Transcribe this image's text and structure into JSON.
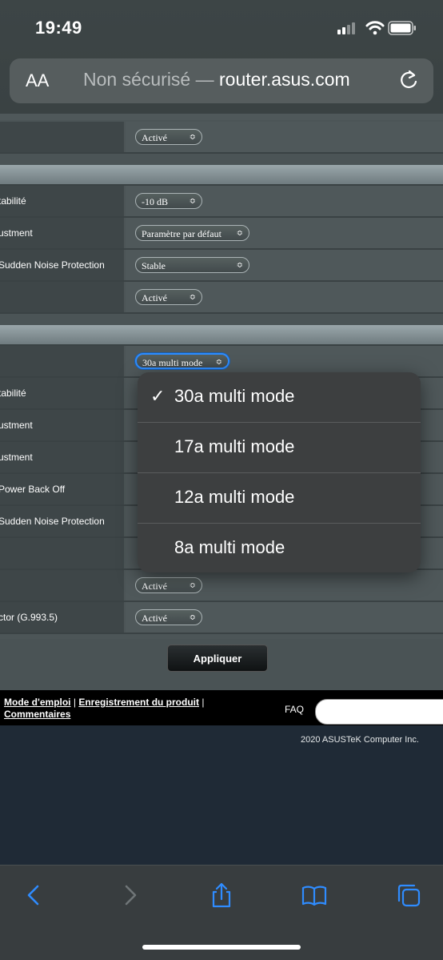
{
  "status_bar": {
    "time": "19:49"
  },
  "safari": {
    "aa": "AA",
    "url_insecure": "Non sécurisé —",
    "url_domain": "router.asus.com"
  },
  "section1": {
    "rows": [
      {
        "label": "",
        "value": "Activé"
      }
    ]
  },
  "section2": {
    "rows": [
      {
        "label": "tabilité",
        "value": "-10 dB"
      },
      {
        "label": "ustment",
        "value": "Paramètre par défaut"
      },
      {
        "label": "Sudden Noise Protection",
        "value": "Stable"
      },
      {
        "label": "",
        "value": "Activé"
      }
    ]
  },
  "section3": {
    "rows": [
      {
        "label": "",
        "value": "30a multi mode"
      },
      {
        "label": "tabilité",
        "value": ""
      },
      {
        "label": "ustment",
        "value": ""
      },
      {
        "label": "ustment",
        "value": ""
      },
      {
        "label": "Power Back Off",
        "value": ""
      },
      {
        "label": "Sudden Noise Protection",
        "value": ""
      },
      {
        "label": "",
        "value": ""
      },
      {
        "label": "",
        "value": "Activé"
      },
      {
        "label": "ctor (G.993.5)",
        "value": "Activé"
      }
    ]
  },
  "apply_label": "Appliquer",
  "footer": {
    "link1": "Mode d'emploi",
    "sep1": " | ",
    "link2": "Enregistrement du produit",
    "sep2": " | ",
    "link3": "Commentaires",
    "faq": "FAQ",
    "copyright": "2020 ASUSTeK Computer Inc. "
  },
  "dropdown": {
    "selected_index": 0,
    "check": "✓",
    "options": [
      "30a multi mode",
      "17a multi mode",
      "12a multi mode",
      "8a multi mode"
    ]
  },
  "icons": {
    "back": "chevron-left-icon",
    "forward": "chevron-right-icon",
    "share": "share-icon",
    "bookmarks": "book-icon",
    "tabs": "tabs-icon"
  },
  "colors": {
    "accent": "#2f8cff",
    "page_bg": "#4c5557"
  }
}
